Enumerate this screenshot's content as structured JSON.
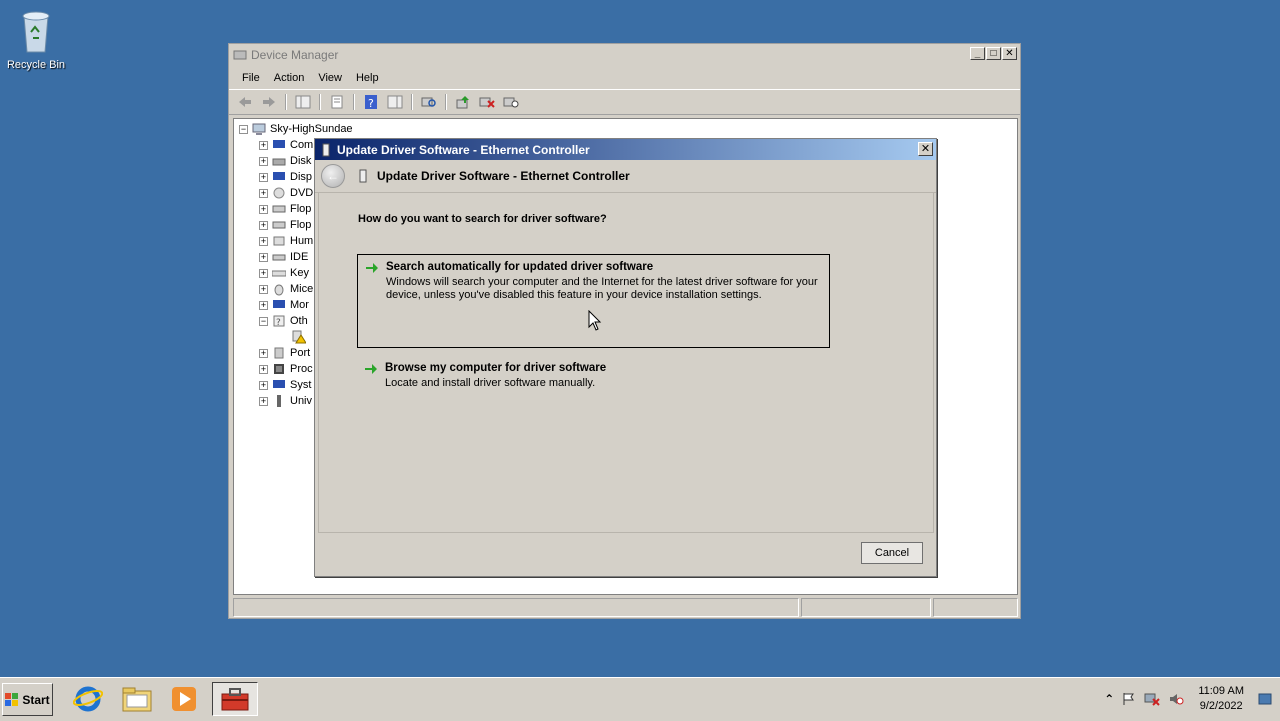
{
  "desktop": {
    "recycle_bin_label": "Recycle Bin"
  },
  "device_manager": {
    "title": "Device Manager",
    "menu": [
      "File",
      "Action",
      "View",
      "Help"
    ],
    "root_node": "Sky-HighSundae",
    "tree_items": [
      "Com",
      "Disk",
      "Disp",
      "DVD",
      "Flop",
      "Flop",
      "Hum",
      "IDE",
      "Key",
      "Mice",
      "Mor",
      "Oth",
      "",
      "Port",
      "Proc",
      "Syst",
      "Univ"
    ]
  },
  "dialog": {
    "title": "Update Driver Software - Ethernet Controller",
    "header_title": "Update Driver Software - Ethernet Controller",
    "question": "How do you want to search for driver software?",
    "option_auto": {
      "title": "Search automatically for updated driver software",
      "description": "Windows will search your computer and the Internet for the latest driver software for your device, unless you've disabled this feature in your device installation settings."
    },
    "option_browse": {
      "title": "Browse my computer for driver software",
      "description": "Locate and install driver software manually."
    },
    "cancel_label": "Cancel"
  },
  "taskbar": {
    "start_label": "Start",
    "clock_time": "11:09 AM",
    "clock_date": "9/2/2022"
  }
}
